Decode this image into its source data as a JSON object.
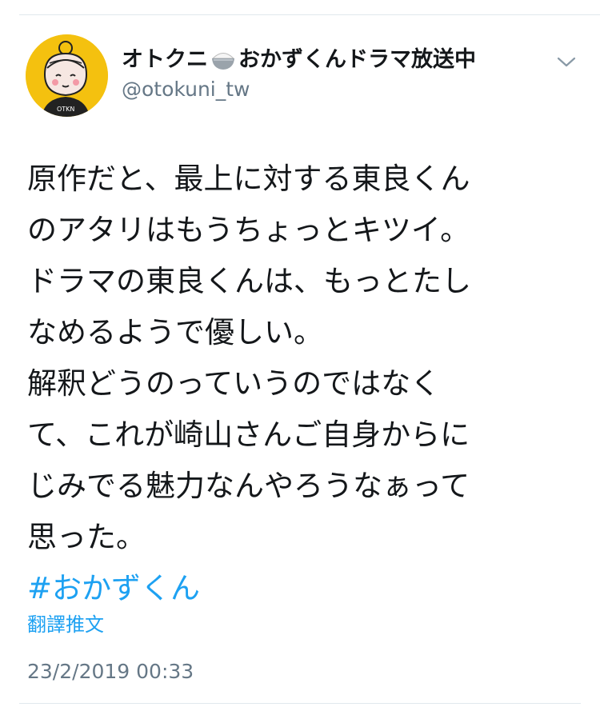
{
  "author": {
    "display_name_before": "オトクニ",
    "display_name_after": "おかずくんドラマ放送中",
    "handle": "@otokuni_tw",
    "avatar_icon": "character-avatar-icon",
    "avatar_bg": "#f4c10f",
    "name_emoji_icon": "rice-bowl-icon"
  },
  "tweet": {
    "lines": [
      "原作だと、最上に対する東良くん",
      "のアタリはもうちょっとキツイ。",
      "ドラマの東良くんは、もっとたし",
      "なめるようで優しい。",
      "解釈どうのっていうのではなく",
      "て、これが崎山さんご自身からに",
      "じみでる魅力なんやろうなぁって",
      "思った。"
    ],
    "hashtag": "#おかずくん"
  },
  "actions": {
    "translate_label": "翻譯推文",
    "caret_icon": "chevron-down-icon"
  },
  "meta": {
    "timestamp": "23/2/2019 00:33"
  },
  "colors": {
    "link": "#1da1f2",
    "secondary": "#657786",
    "text": "#14171a"
  }
}
